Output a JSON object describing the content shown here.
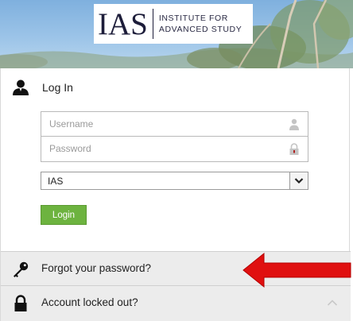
{
  "header": {
    "logo_mark": "IAS",
    "logo_line1": "INSTITUTE FOR",
    "logo_line2": "ADVANCED STUDY"
  },
  "login": {
    "title": "Log In",
    "username_placeholder": "Username",
    "password_placeholder": "Password",
    "domain_value": "IAS",
    "submit_label": "Login"
  },
  "links": {
    "forgot_password": "Forgot your password?",
    "account_locked": "Account locked out?"
  },
  "colors": {
    "login_button": "#6db33f",
    "arrow": "#e01010",
    "row_background": "#ececec"
  },
  "icons": [
    "user-icon",
    "person-icon",
    "lock-icon",
    "chevron-down-icon",
    "key-icon",
    "padlock-icon",
    "chevron-up-icon"
  ]
}
